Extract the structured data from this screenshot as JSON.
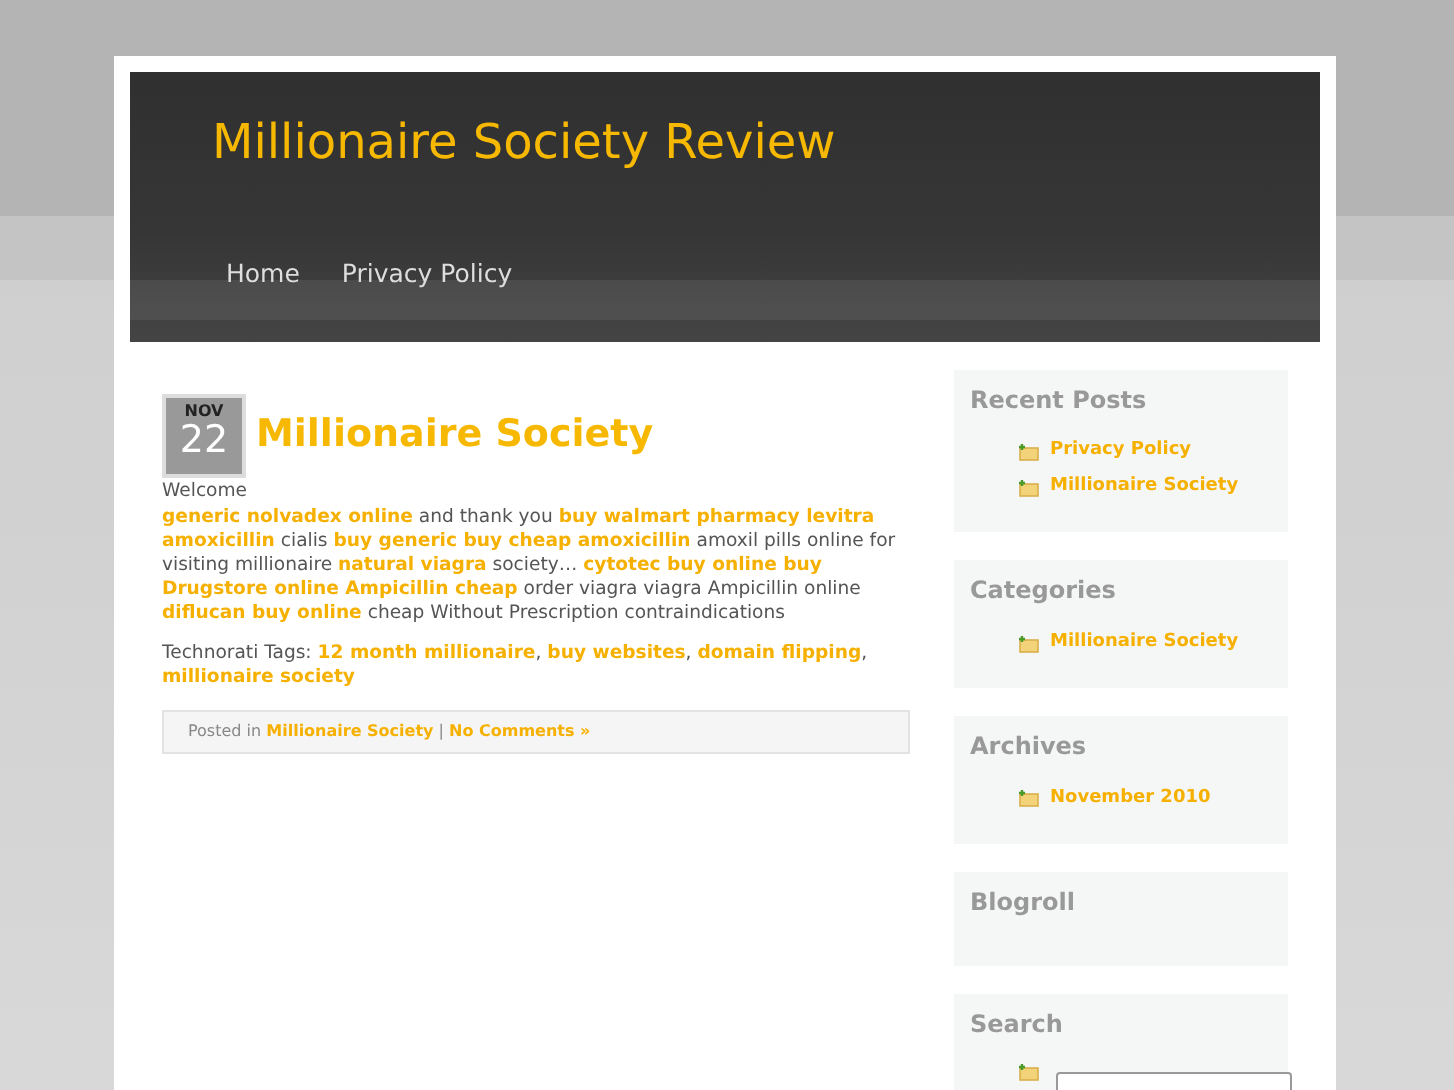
{
  "header": {
    "site_title": "Millionaire Society Review",
    "nav": [
      {
        "label": "Home",
        "selected": false
      },
      {
        "label": "Privacy Policy",
        "selected": false
      }
    ]
  },
  "post": {
    "date_month": "NOV",
    "date_day": "22",
    "title": "Millionaire Society",
    "intro": "Welcome",
    "body": "**generic nolvadex online** and thank you **buy walmart pharmacy levitra amoxicillin** cialis **buy generic buy cheap amoxicillin** amoxil pills online for visiting millionaire **natural viagra** society… **cytotec buy online buy Drugstore online Ampicillin cheap** order viagra viagra Ampicillin online **diflucan buy online** cheap Without Prescription contraindications",
    "tags": "Technorati Tags: **12 month millionaire**, **buy websites**, **domain flipping**, **millionaire society**",
    "footer": "Posted in **Millionaire Society** | **No Comments »**"
  },
  "sidebar": [
    {
      "title": "Recent Posts",
      "items": [
        "Privacy Policy",
        "Millionaire Society"
      ]
    },
    {
      "title": "Categories",
      "items": [
        "Millionaire Society"
      ]
    },
    {
      "title": "Archives",
      "items": [
        "November 2010"
      ]
    },
    {
      "title": "Blogroll"
    },
    {
      "title": "Search",
      "search_field": true
    }
  ]
}
